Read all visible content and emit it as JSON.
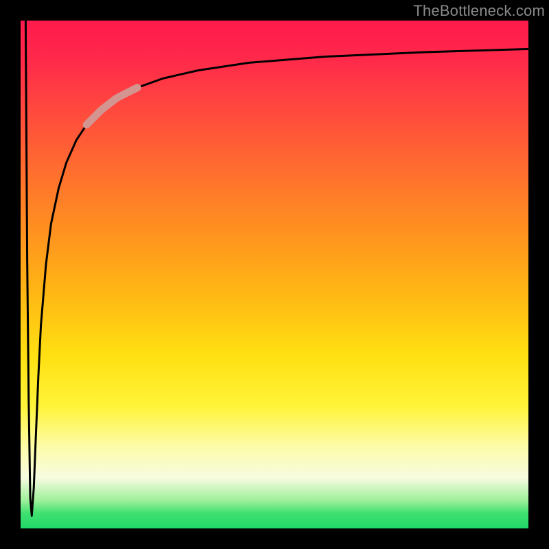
{
  "watermark": "TheBottleneck.com",
  "chart_data": {
    "type": "line",
    "title": "",
    "xlabel": "",
    "ylabel": "",
    "xlim": [
      0,
      100
    ],
    "ylim": [
      0,
      100
    ],
    "grid": false,
    "series": [
      {
        "name": "curve",
        "x": [
          1.0,
          1.3,
          1.6,
          1.9,
          2.2,
          2.6,
          3.0,
          3.5,
          4.0,
          5.0,
          6.0,
          7.5,
          9.0,
          11.0,
          13.0,
          16.0,
          19.0,
          23.0,
          28.0,
          35.0,
          45.0,
          60.0,
          80.0,
          100.0
        ],
        "y": [
          100.0,
          53.0,
          25.0,
          6.0,
          2.5,
          8.0,
          18.0,
          30.0,
          40.0,
          52.0,
          60.0,
          67.0,
          72.0,
          76.5,
          79.5,
          82.5,
          84.8,
          86.8,
          88.6,
          90.2,
          91.7,
          92.9,
          93.8,
          94.4
        ]
      },
      {
        "name": "highlight",
        "x": [
          13.0,
          23.0
        ],
        "y": [
          79.5,
          86.8
        ]
      }
    ],
    "highlight_color": "#d4948f",
    "curve_color": "#000000"
  }
}
